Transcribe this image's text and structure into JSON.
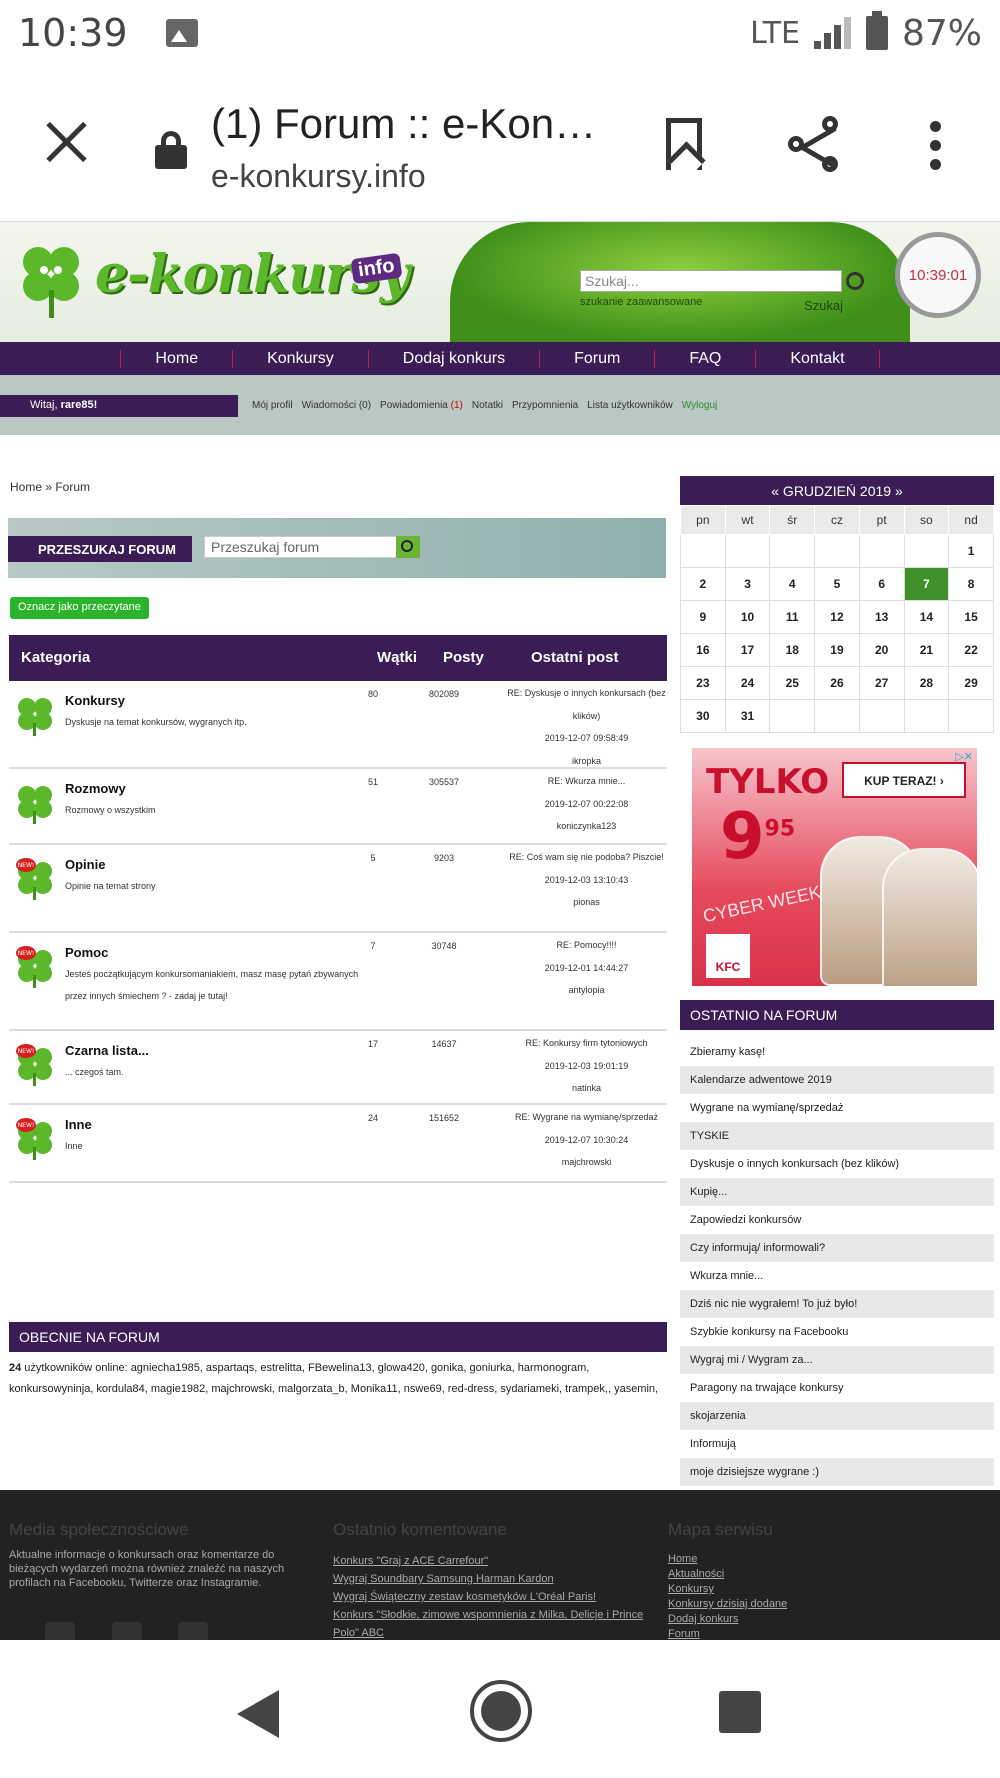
{
  "status": {
    "time": "10:39",
    "network": "LTE",
    "battery": "87%"
  },
  "browser": {
    "title": "(1) Forum :: e-Kon…",
    "url": "e-konkursy.info"
  },
  "site": {
    "logo_text": "e-konkursy",
    "logo_suffix": "info",
    "search_placeholder": "Szukaj...",
    "search_label": "Szukaj",
    "advanced_search": "szukanie zaawansowane",
    "clock": "10:39:01",
    "nav": [
      "Home",
      "Konkursy",
      "Dodaj konkurs",
      "Forum",
      "FAQ",
      "Kontakt"
    ],
    "greeting": "Witaj, ",
    "username": "rare85!",
    "user_links": {
      "profile": "Mój profil",
      "messages": "Wiadomości (0)",
      "notifications": "Powiadomienia",
      "notifications_count": "(1)",
      "notes": "Notatki",
      "reminders": "Przypomnienia",
      "users": "Lista użytkowników",
      "logout": "Wyloguj"
    },
    "breadcrumb": "Home » Forum",
    "forum_search_label": "PRZESZUKAJ FORUM",
    "forum_search_placeholder": "Przeszukaj forum",
    "mark_read": "Oznacz jako przeczytane",
    "table_headers": {
      "category": "Kategoria",
      "threads": "Wątki",
      "posts": "Posty",
      "last_post": "Ostatni post"
    },
    "categories": [
      {
        "name": "Konkursy",
        "desc": "Dyskusje na temat konkursów, wygranych itp.",
        "threads": "80",
        "posts": "802089",
        "last_title": "RE: Dyskusje o innych konkursach (bez klików)",
        "last_date": "2019-12-07 09:58:49",
        "last_user": "ikropka",
        "is_new": false
      },
      {
        "name": "Rozmowy",
        "desc": "Rozmowy o wszystkim",
        "threads": "51",
        "posts": "305537",
        "last_title": "RE: Wkurza mnie...",
        "last_date": "2019-12-07 00:22:08",
        "last_user": "koniczynka123",
        "is_new": false
      },
      {
        "name": "Opinie",
        "desc": "Opinie na temat strony",
        "threads": "5",
        "posts": "9203",
        "last_title": "RE: Coś wam się nie podoba? Piszcie!",
        "last_date": "2019-12-03 13:10:43",
        "last_user": "pionas",
        "is_new": true
      },
      {
        "name": "Pomoc",
        "desc": "Jesteś początkującym konkursomaniakiem, masz masę pytań zbywanych przez innych śmiechem ? - zadaj je tutaj!",
        "threads": "7",
        "posts": "30748",
        "last_title": "RE: Pomocy!!!!",
        "last_date": "2019-12-01 14:44:27",
        "last_user": "antylopia",
        "is_new": true
      },
      {
        "name": "Czarna lista...",
        "desc": "... czegoś tam.",
        "threads": "17",
        "posts": "14637",
        "last_title": "RE: Konkursy firm tytoniowych",
        "last_date": "2019-12-03 19:01:19",
        "last_user": "natinka",
        "is_new": true
      },
      {
        "name": "Inne",
        "desc": "Inne",
        "threads": "24",
        "posts": "151652",
        "last_title": "RE: Wygrane na wymianę/sprzedaż",
        "last_date": "2019-12-07 10:30:24",
        "last_user": "majchrowski",
        "is_new": true
      }
    ],
    "online_header": "OBECNIE NA FORUM",
    "online_count": "24",
    "online_text": " użytkowników online: agniecha1985, aspartaqs, estrelitta, FBewelina13, glowa420, gonika, goniurka, harmonogram, konkursowyninja, kordula84, magie1982, majchrowski, malgorzata_b, Monika11, nswe69, red-dress, sydariameki, trampek,, yasemin,",
    "calendar": {
      "title": "« GRUDZIEŃ 2019 »",
      "days": [
        "pn",
        "wt",
        "śr",
        "cz",
        "pt",
        "so",
        "nd"
      ],
      "weeks": [
        [
          "",
          "",
          "",
          "",
          "",
          "",
          "1"
        ],
        [
          "2",
          "3",
          "4",
          "5",
          "6",
          "7",
          "8"
        ],
        [
          "9",
          "10",
          "11",
          "12",
          "13",
          "14",
          "15"
        ],
        [
          "16",
          "17",
          "18",
          "19",
          "20",
          "21",
          "22"
        ],
        [
          "23",
          "24",
          "25",
          "26",
          "27",
          "28",
          "29"
        ],
        [
          "30",
          "31",
          "",
          "",
          "",
          "",
          ""
        ]
      ],
      "today": "7"
    },
    "ad": {
      "headline": "TYLKO",
      "price": "9",
      "price_sup": "95",
      "cta": "KUP TERAZ! ›",
      "tagline": "CYBER WEEK",
      "brand": "KFC"
    },
    "recent_header": "OSTATNIO NA FORUM",
    "recent": [
      "Zbieramy kasę!",
      "Kalendarze adwentowe 2019",
      "Wygrane na wymianę/sprzedaż",
      "TYSKIE",
      "Dyskusje o innych konkursach (bez klików)",
      "Kupię...",
      "Zapowiedzi konkursów",
      "Czy informują/ informowali?",
      "Wkurza mnie...",
      "Dziś nic nie wygrałem! To już było!",
      "Szybkie konkursy na Facebooku",
      "Wygraj mi / Wygram za...",
      "Paragony na trwające konkursy",
      "skojarzenia",
      "Informują",
      "moje dzisiejsze wygrane :)"
    ],
    "footer": {
      "social_header": "Media społecznościowe",
      "social_text": "Aktualne informacje o konkursach oraz komentarze do bieżących wydarzeń można również znaleźć na naszych profilach na Facebooku, Twitterze oraz Instagramie.",
      "comments_header": "Ostatnio komentowane",
      "comments": [
        "Konkurs \"Graj z ACE Carrefour\"",
        "Wygraj Soundbary Samsung Harman Kardon",
        "Wygraj Świąteczny zestaw kosmetyków L'Oréal Paris!",
        "Konkurs \"Słodkie, zimowe wspomnienia z Milka, Delicje i Prince Polo\" ABC"
      ],
      "map_header": "Mapa serwisu",
      "map_links": [
        "Home",
        "Aktualności",
        "Konkursy",
        "Konkursy dzisiaj dodane",
        "Dodaj konkurs",
        "Forum"
      ]
    }
  }
}
